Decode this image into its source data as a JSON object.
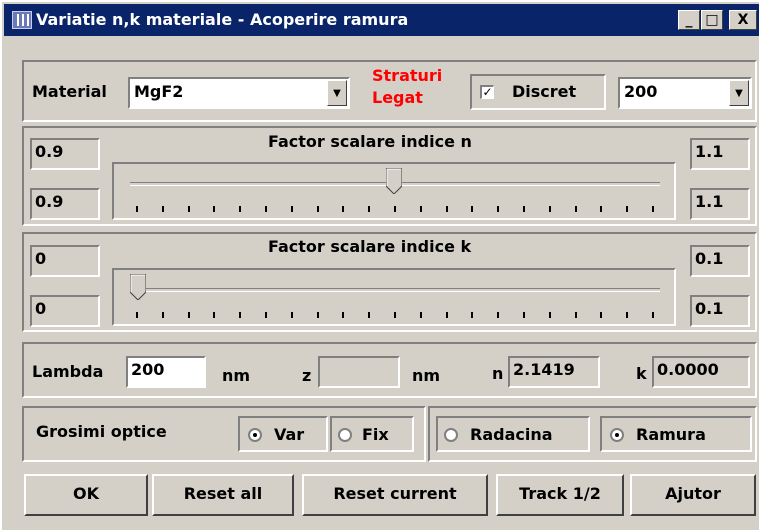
{
  "window": {
    "title": "Variatie n,k materiale - Acoperire ramura",
    "minimize_glyph": "_",
    "maximize_glyph": "□",
    "close_glyph": "X"
  },
  "material_row": {
    "material_label": "Material",
    "material_value": "MgF2",
    "straturi_label": "Straturi",
    "legat_label": "Legat",
    "discret_label": "Discret",
    "discret_checked": true,
    "count_value": "200",
    "accent_red": "#ff0000"
  },
  "n_panel": {
    "title": "Factor scalare indice n",
    "min_top": "0.9",
    "min_bottom": "0.9",
    "max_top": "1.1",
    "max_bottom": "1.1",
    "slider_position": 0.5
  },
  "k_panel": {
    "title": "Factor scalare indice k",
    "min_top": "0",
    "min_bottom": "0",
    "max_top": "0.1",
    "max_bottom": "0.1",
    "slider_position": 0.0
  },
  "lambda_row": {
    "lambda_label": "Lambda",
    "lambda_value": "200",
    "nm_unit_1": "nm",
    "z_label": "z",
    "z_value": "",
    "nm_unit_2": "nm",
    "n_label": "n",
    "n_value": "2.1419",
    "k_label": "k",
    "k_value": "0.0000"
  },
  "grosimi_row": {
    "label": "Grosimi optice",
    "var_label": "Var",
    "var_selected": true,
    "fix_label": "Fix",
    "fix_selected": false,
    "radacina_label": "Radacina",
    "radacina_selected": false,
    "ramura_label": "Ramura",
    "ramura_selected": true
  },
  "buttons": {
    "ok": "OK",
    "reset_all": "Reset all",
    "reset_current": "Reset current",
    "track": "Track 1/2",
    "ajutor": "Ajutor"
  },
  "icons": [
    "app-grid-icon",
    "minimize-icon",
    "maximize-icon",
    "close-icon",
    "dropdown-arrow-icon",
    "checkmark-icon",
    "radio-dot-icon",
    "slider-thumb-icon"
  ]
}
